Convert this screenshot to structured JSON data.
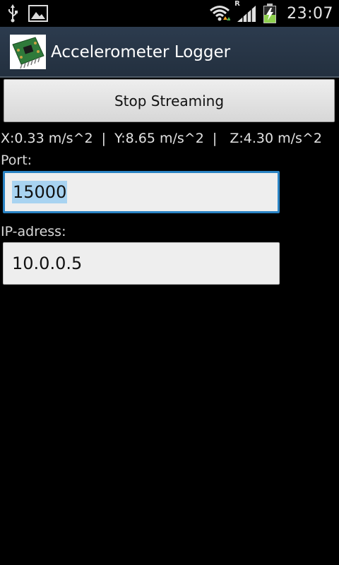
{
  "status_bar": {
    "time": "23:07",
    "left_icons": [
      "usb-icon",
      "image-icon"
    ],
    "right_icons": [
      "wifi-icon",
      "roaming-signal-icon",
      "battery-charging-icon"
    ],
    "roaming_indicator": "R"
  },
  "action_bar": {
    "title": "Accelerometer Logger",
    "icon": "circuit-board-icon",
    "background_color": "#26344a"
  },
  "button": {
    "label": "Stop Streaming"
  },
  "readout": {
    "text": "X:0.33 m/s^2  |  Y:8.65 m/s^2  |   Z:4.30 m/s^2"
  },
  "port": {
    "label": "Port:",
    "value": "15000",
    "focused": true,
    "selected": true,
    "focus_color": "#2a83c4"
  },
  "ip": {
    "label": "IP-adress:",
    "value": "10.0.0.5"
  }
}
